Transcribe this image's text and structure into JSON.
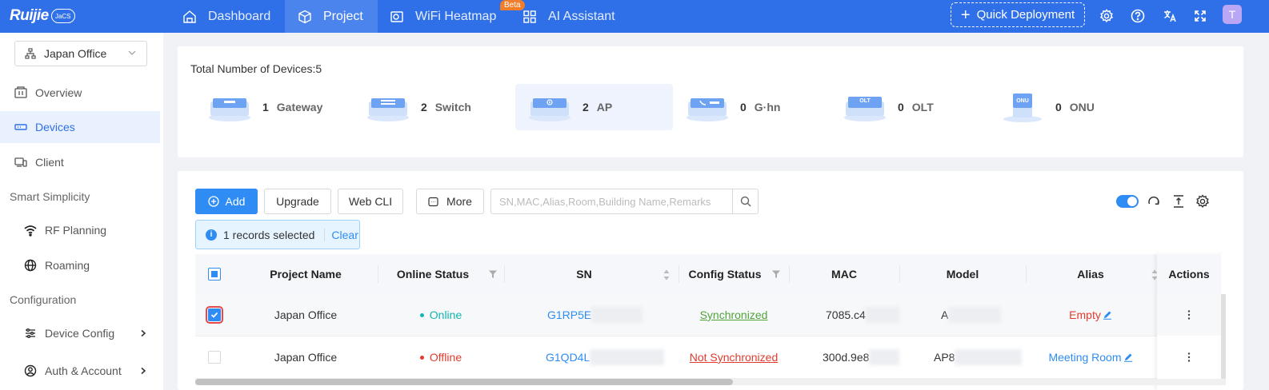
{
  "app": {
    "logo_text": "Ruijie",
    "logo_sub": "JaCS"
  },
  "topnav": {
    "items": [
      {
        "label": "Dashboard",
        "icon": "home-icon"
      },
      {
        "label": "Project",
        "icon": "cube-icon",
        "active": true
      },
      {
        "label": "WiFi Heatmap",
        "icon": "heatmap-icon",
        "badge": "Beta"
      },
      {
        "label": "AI Assistant",
        "icon": "grid-icon"
      }
    ],
    "quick_deployment": "Quick Deployment",
    "avatar_initial": "T",
    "icons": [
      "settings-icon",
      "help-icon",
      "translate-icon",
      "fullscreen-icon"
    ]
  },
  "sidebar": {
    "site": "Japan Office",
    "items": [
      {
        "label": "Overview",
        "icon": "overview-icon"
      },
      {
        "label": "Devices",
        "icon": "devices-icon",
        "active": true
      },
      {
        "label": "Client",
        "icon": "client-icon"
      }
    ],
    "groups": [
      {
        "label": "Smart Simplicity",
        "items": [
          {
            "label": "RF Planning",
            "icon": "wifi-icon"
          },
          {
            "label": "Roaming",
            "icon": "globe-icon"
          }
        ]
      },
      {
        "label": "Configuration",
        "items": [
          {
            "label": "Device Config",
            "icon": "sliders-icon"
          },
          {
            "label": "Auth & Account",
            "icon": "user-circle-icon"
          }
        ]
      }
    ]
  },
  "summary": {
    "title": "Total Number of Devices:5",
    "types": [
      {
        "count": "1",
        "label": "Gateway"
      },
      {
        "count": "2",
        "label": "Switch"
      },
      {
        "count": "2",
        "label": "AP",
        "active": true
      },
      {
        "count": "0",
        "label": "G·hn"
      },
      {
        "count": "0",
        "label": "OLT"
      },
      {
        "count": "0",
        "label": "ONU"
      }
    ]
  },
  "toolbar": {
    "add": "Add",
    "upgrade": "Upgrade",
    "webcli": "Web CLI",
    "more": "More",
    "search_placeholder": "SN,MAC,Alias,Room,Building Name,Remarks",
    "selected_text": "1 records selected",
    "clear": "Clear"
  },
  "table": {
    "columns": [
      "Project Name",
      "Online Status",
      "SN",
      "Config Status",
      "MAC",
      "Model",
      "Alias",
      "Actions"
    ],
    "rows": [
      {
        "project": "Japan Office",
        "status": "Online",
        "status_color": "#13b5b1",
        "sn": "G1RP5E",
        "config": "Synchronized",
        "mac": "7085.c4",
        "model": "A",
        "alias": "Empty",
        "selected": true
      },
      {
        "project": "Japan Office",
        "status": "Offline",
        "status_color": "#e23b2e",
        "sn": "G1QD4L",
        "config": "Not Synchronized",
        "mac": "300d.9e8",
        "model": "AP8",
        "alias": "Meeting Room",
        "selected": false
      }
    ]
  },
  "colors": {
    "brand": "#2f6fe8",
    "primary": "#2f8cf4",
    "online": "#13b5b1",
    "offline": "#e23b2e",
    "synced": "#52a23a"
  }
}
